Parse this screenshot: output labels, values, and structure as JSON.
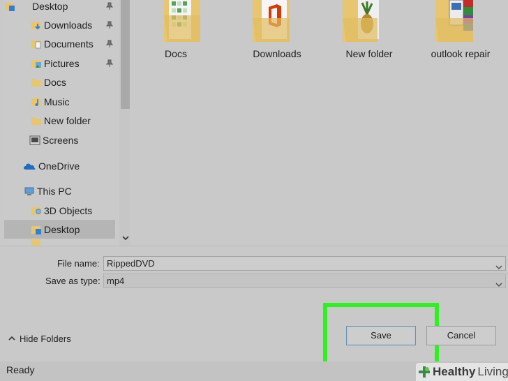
{
  "nav": {
    "items": [
      {
        "label": "Desktop",
        "icon": "desktop-folder-icon",
        "pinned": true
      },
      {
        "label": "Downloads",
        "icon": "downloads-folder-icon",
        "pinned": true
      },
      {
        "label": "Documents",
        "icon": "documents-folder-icon",
        "pinned": true
      },
      {
        "label": "Pictures",
        "icon": "pictures-folder-icon",
        "pinned": true
      },
      {
        "label": "Docs",
        "icon": "folder-icon",
        "pinned": false
      },
      {
        "label": "Music",
        "icon": "music-folder-icon",
        "pinned": false
      },
      {
        "label": "New folder",
        "icon": "folder-icon",
        "pinned": false
      },
      {
        "label": "Screens",
        "icon": "screens-folder-icon",
        "pinned": false
      },
      {
        "label": "OneDrive",
        "icon": "onedrive-cloud-icon",
        "pinned": false
      },
      {
        "label": "This PC",
        "icon": "this-pc-icon",
        "pinned": false
      },
      {
        "label": "3D Objects",
        "icon": "3d-objects-folder-icon",
        "pinned": false
      },
      {
        "label": "Desktop",
        "icon": "desktop-folder-icon",
        "pinned": false,
        "selected": true
      }
    ]
  },
  "content": {
    "folders": [
      {
        "label": "Docs",
        "preview": "spreadsheet"
      },
      {
        "label": "Downloads",
        "preview": "office-document"
      },
      {
        "label": "New folder",
        "preview": "pineapple-photo"
      },
      {
        "label": "outlook repair",
        "preview": "installer-app"
      }
    ]
  },
  "form": {
    "file_name_label": "File name:",
    "file_name_value": "RippedDVD",
    "save_type_label": "Save as type:",
    "save_type_value": "mp4"
  },
  "footer": {
    "hide_folders": "Hide Folders",
    "save": "Save",
    "cancel": "Cancel",
    "status": "Ready"
  },
  "watermark": {
    "part1": "Healthy",
    "part2": "Living"
  },
  "colors": {
    "highlight": "#2ef21f",
    "folder": "#e8c670",
    "onedrive": "#1b6ec2"
  }
}
